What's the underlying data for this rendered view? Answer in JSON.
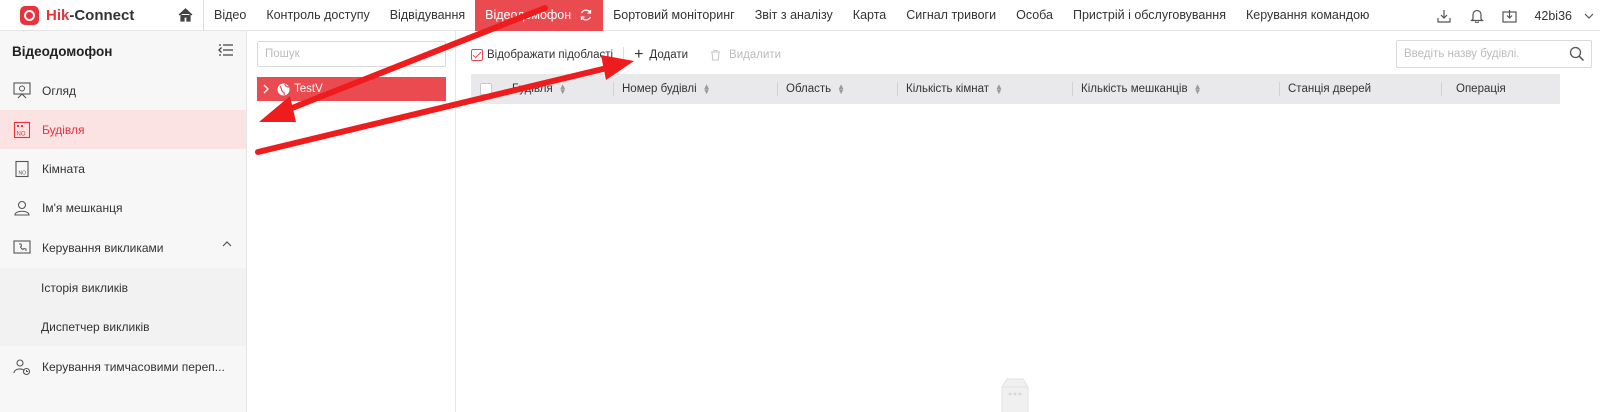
{
  "app": {
    "brand_red": "Hik",
    "brand_rest": "-Connect",
    "accent": "#ea4b50"
  },
  "nav": {
    "items": [
      {
        "label": "Відео"
      },
      {
        "label": "Контроль доступу"
      },
      {
        "label": "Відвідування"
      },
      {
        "label": "Відеодомофон",
        "active": true
      },
      {
        "label": "Бортовий моніторинг"
      },
      {
        "label": "Звіт з аналізу"
      },
      {
        "label": "Карта"
      },
      {
        "label": "Сигнал тривоги"
      },
      {
        "label": "Особа"
      },
      {
        "label": "Пристрій і обслуговування"
      },
      {
        "label": "Керування командою"
      }
    ],
    "user": "42bi36"
  },
  "sidebar": {
    "title": "Відеодомофон",
    "items": [
      {
        "label": "Огляд",
        "icon": "overview-icon"
      },
      {
        "label": "Будівля",
        "icon": "building-icon",
        "active": true
      },
      {
        "label": "Кімната",
        "icon": "room-icon"
      },
      {
        "label": "Ім'я мешканця",
        "icon": "resident-icon"
      },
      {
        "label": "Керування викликами",
        "icon": "call-management-icon",
        "expanded": true
      },
      {
        "label": "Історія викликів",
        "sub": true
      },
      {
        "label": "Диспетчер викликів",
        "sub": true
      },
      {
        "label": "Керування тимчасовими переп...",
        "icon": "temporary-pass-icon"
      }
    ]
  },
  "tree": {
    "search_placeholder": "Пошук",
    "node_label": "TestV"
  },
  "toolbar": {
    "show_subareas": "Відображати підобласті",
    "add": "Додати",
    "delete": "Видалити",
    "search_placeholder": "Введіть назву будівлі."
  },
  "table": {
    "columns": [
      {
        "label": "Будівля",
        "sortable": true
      },
      {
        "label": "Номер будівлі",
        "sortable": true
      },
      {
        "label": "Область",
        "sortable": true
      },
      {
        "label": "Кількість кімнат",
        "sortable": true
      },
      {
        "label": "Кількість мешканців",
        "sortable": true
      },
      {
        "label": "Станція дверей",
        "sortable": false
      },
      {
        "label": "Операція",
        "sortable": false
      }
    ],
    "rows": []
  }
}
